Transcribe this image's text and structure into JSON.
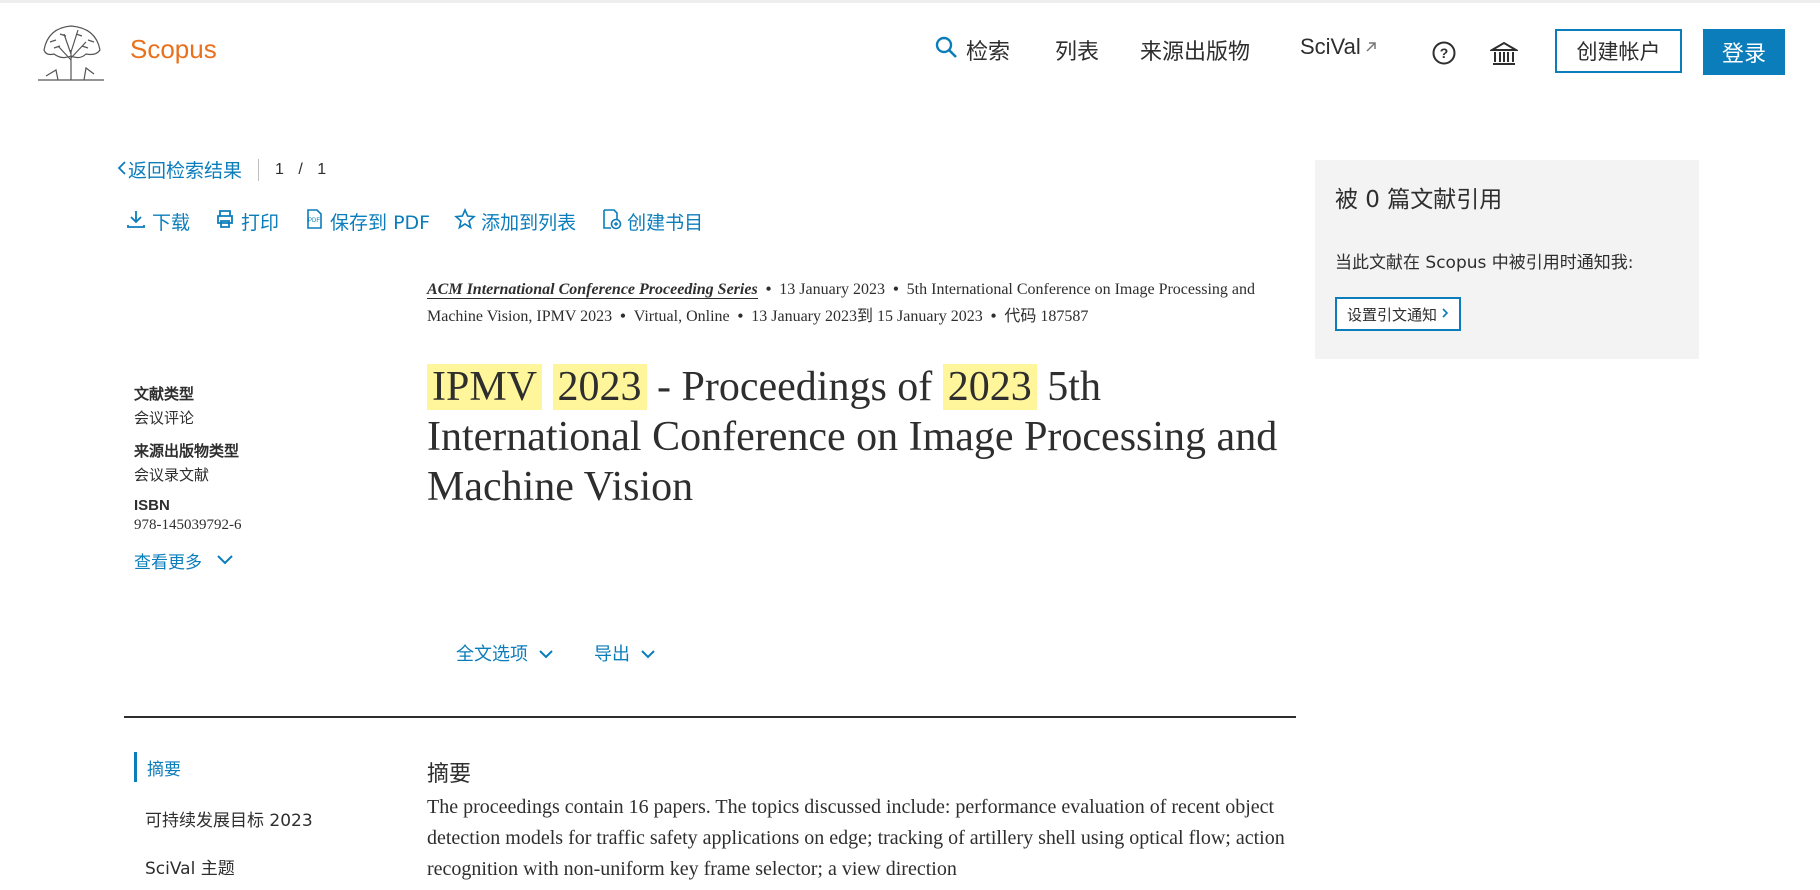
{
  "header": {
    "brand": "Scopus",
    "nav": {
      "search": "检索",
      "lists": "列表",
      "sources": "来源出版物",
      "scival": "SciVal"
    },
    "create_account": "创建帐户",
    "login": "登录",
    "accent": "#0c7dbb",
    "brand_color": "#e9711c"
  },
  "back": {
    "label": "返回检索结果",
    "page_current": "1",
    "page_sep": "/",
    "page_total": "1"
  },
  "actions": [
    {
      "label": "下载",
      "icon": "download-icon"
    },
    {
      "label": "打印",
      "icon": "print-icon"
    },
    {
      "label": "保存到 PDF",
      "icon": "pdf-icon"
    },
    {
      "label": "添加到列表",
      "icon": "star-icon"
    },
    {
      "label": "创建书目",
      "icon": "bibliography-icon"
    }
  ],
  "meta": {
    "series": "ACM International Conference Proceeding Series",
    "date": "13 January 2023",
    "conference": "5th International Conference on Image Processing and Machine Vision, IPMV 2023",
    "location": "Virtual, Online",
    "dates_range": "13 January 2023到 15 January 2023",
    "code": "代码 187587"
  },
  "info": {
    "doc_type_label": "文献类型",
    "doc_type_value": "会议评论",
    "source_type_label": "来源出版物类型",
    "source_type_value": "会议录文献",
    "isbn_label": "ISBN",
    "isbn_value": "978-145039792-6",
    "show_more": "查看更多"
  },
  "title": {
    "hl1": "IPMV",
    "hl2": "2023",
    "mid": "- Proceedings of",
    "hl3": "2023",
    "rest": "5th International Conference on Image Processing and Machine Vision",
    "highlight_color": "#fff59a"
  },
  "options": {
    "full_text": "全文选项",
    "export": "导出"
  },
  "sidenav": {
    "abstract": "摘要",
    "sdg": "可持续发展目标 2023",
    "scival_topics": "SciVal 主题"
  },
  "abstract": {
    "heading": "摘要",
    "text": "The proceedings contain 16 papers. The topics discussed include: performance evaluation of recent object detection models for traffic safety applications on edge; tracking of artillery shell using optical flow; action recognition with non-uniform key frame selector; a view direction"
  },
  "citations": {
    "heading": "被 0 篇文献引用",
    "note": "当此文献在 Scopus 中被引用时通知我:",
    "set_alert": "设置引文通知"
  }
}
